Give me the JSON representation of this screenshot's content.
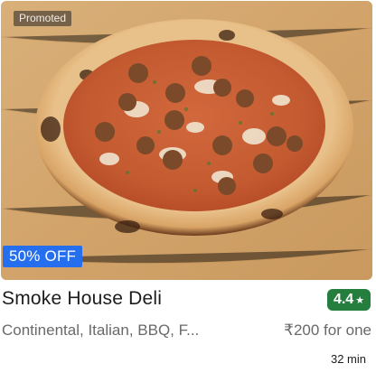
{
  "restaurant": {
    "name": "Smoke House Deli",
    "rating": "4.4",
    "rating_color": "#267e3e",
    "cuisines": "Continental, Italian, BBQ, F...",
    "price": "₹200 for one",
    "delivery_time": "32 min"
  },
  "badges": {
    "promoted": "Promoted",
    "offer": "50% OFF",
    "offer_color": "#256fef"
  },
  "image": {
    "subject": "pizza with sausage meatballs on a wooden board",
    "icon": "star-icon"
  }
}
